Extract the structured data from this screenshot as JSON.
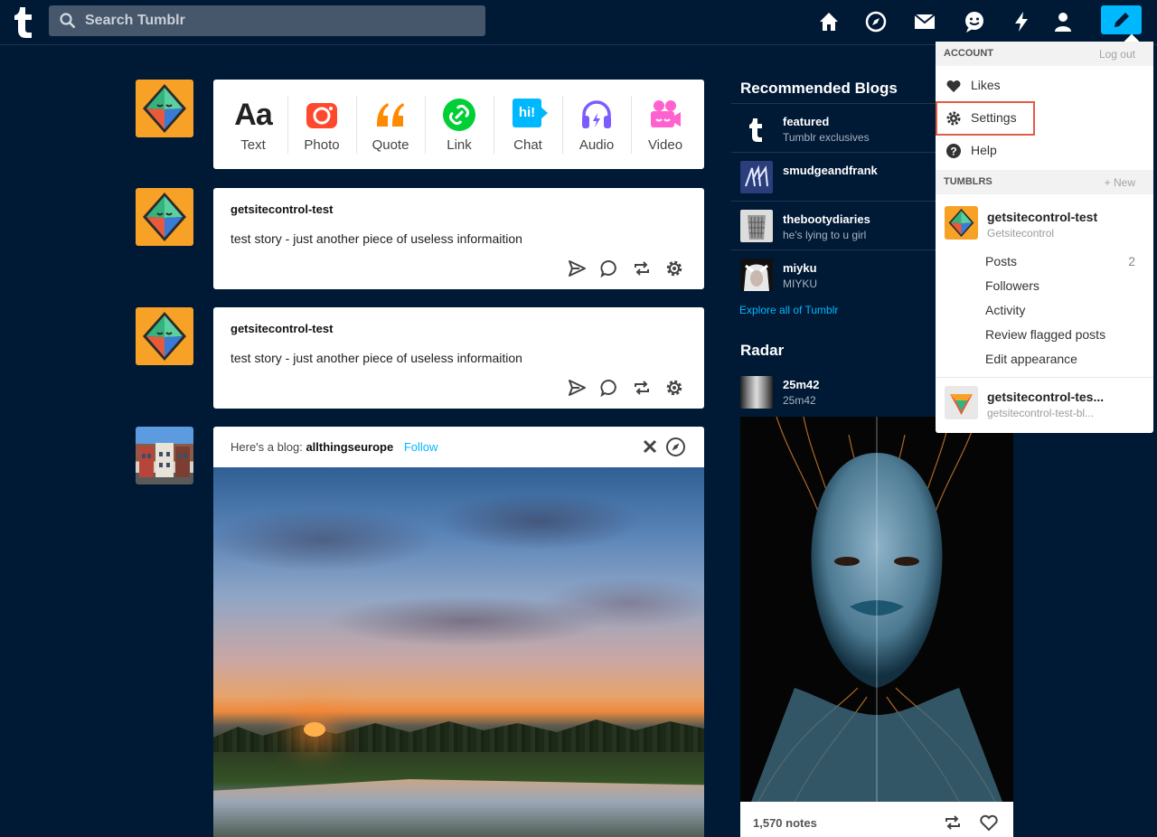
{
  "search": {
    "placeholder": "Search Tumblr"
  },
  "post_types": [
    {
      "label": "Text",
      "glyph": "Aa",
      "color": "#222222"
    },
    {
      "label": "Photo",
      "color": "#ff492f"
    },
    {
      "label": "Quote",
      "glyph": "66",
      "color": "#ff8a00"
    },
    {
      "label": "Link",
      "color": "#00cf35"
    },
    {
      "label": "Chat",
      "glyph": "hi!",
      "color": "#00b8ff"
    },
    {
      "label": "Audio",
      "color": "#7c5cff"
    },
    {
      "label": "Video",
      "color": "#ff62ce"
    }
  ],
  "posts": [
    {
      "blog": "getsitecontrol-test",
      "body": "test story - just another piece of useless informaition"
    },
    {
      "blog": "getsitecontrol-test",
      "body": "test story - just another piece of useless informaition"
    }
  ],
  "blog_suggestion": {
    "prefix": "Here's a blog:",
    "blog": "allthingseurope",
    "follow": "Follow"
  },
  "recommended": {
    "title": "Recommended Blogs",
    "blogs": [
      {
        "name": "featured",
        "sub": "Tumblr exclusives"
      },
      {
        "name": "smudgeandfrank",
        "sub": ""
      },
      {
        "name": "thebootydiaries",
        "sub": "he's lying to u girl"
      },
      {
        "name": "miyku",
        "sub": "MIYKU"
      }
    ],
    "explore": "Explore all of Tumblr"
  },
  "radar": {
    "title": "Radar",
    "name": "25m42",
    "sub": "25m42",
    "notes": "1,570 notes"
  },
  "dropdown": {
    "account_header": "ACCOUNT",
    "logout": "Log out",
    "items": [
      {
        "label": "Likes",
        "icon": "heart-icon"
      },
      {
        "label": "Settings",
        "icon": "gear-icon"
      },
      {
        "label": "Help",
        "icon": "help-icon"
      }
    ],
    "tumblrs_header": "TUMBLRS",
    "new": "+ New",
    "primary_blog": {
      "name": "getsitecontrol-test",
      "title": "Getsitecontrol"
    },
    "blog_links": [
      {
        "label": "Posts",
        "count": "2"
      },
      {
        "label": "Followers",
        "count": ""
      },
      {
        "label": "Activity",
        "count": ""
      },
      {
        "label": "Review flagged posts",
        "count": ""
      },
      {
        "label": "Edit appearance",
        "count": ""
      }
    ],
    "secondary_blog": {
      "name": "getsitecontrol-tes...",
      "url": "getsitecontrol-test-bl..."
    }
  },
  "colors": {
    "background": "#001935",
    "accent": "#00b8ff",
    "highlight": "#e25b45"
  }
}
